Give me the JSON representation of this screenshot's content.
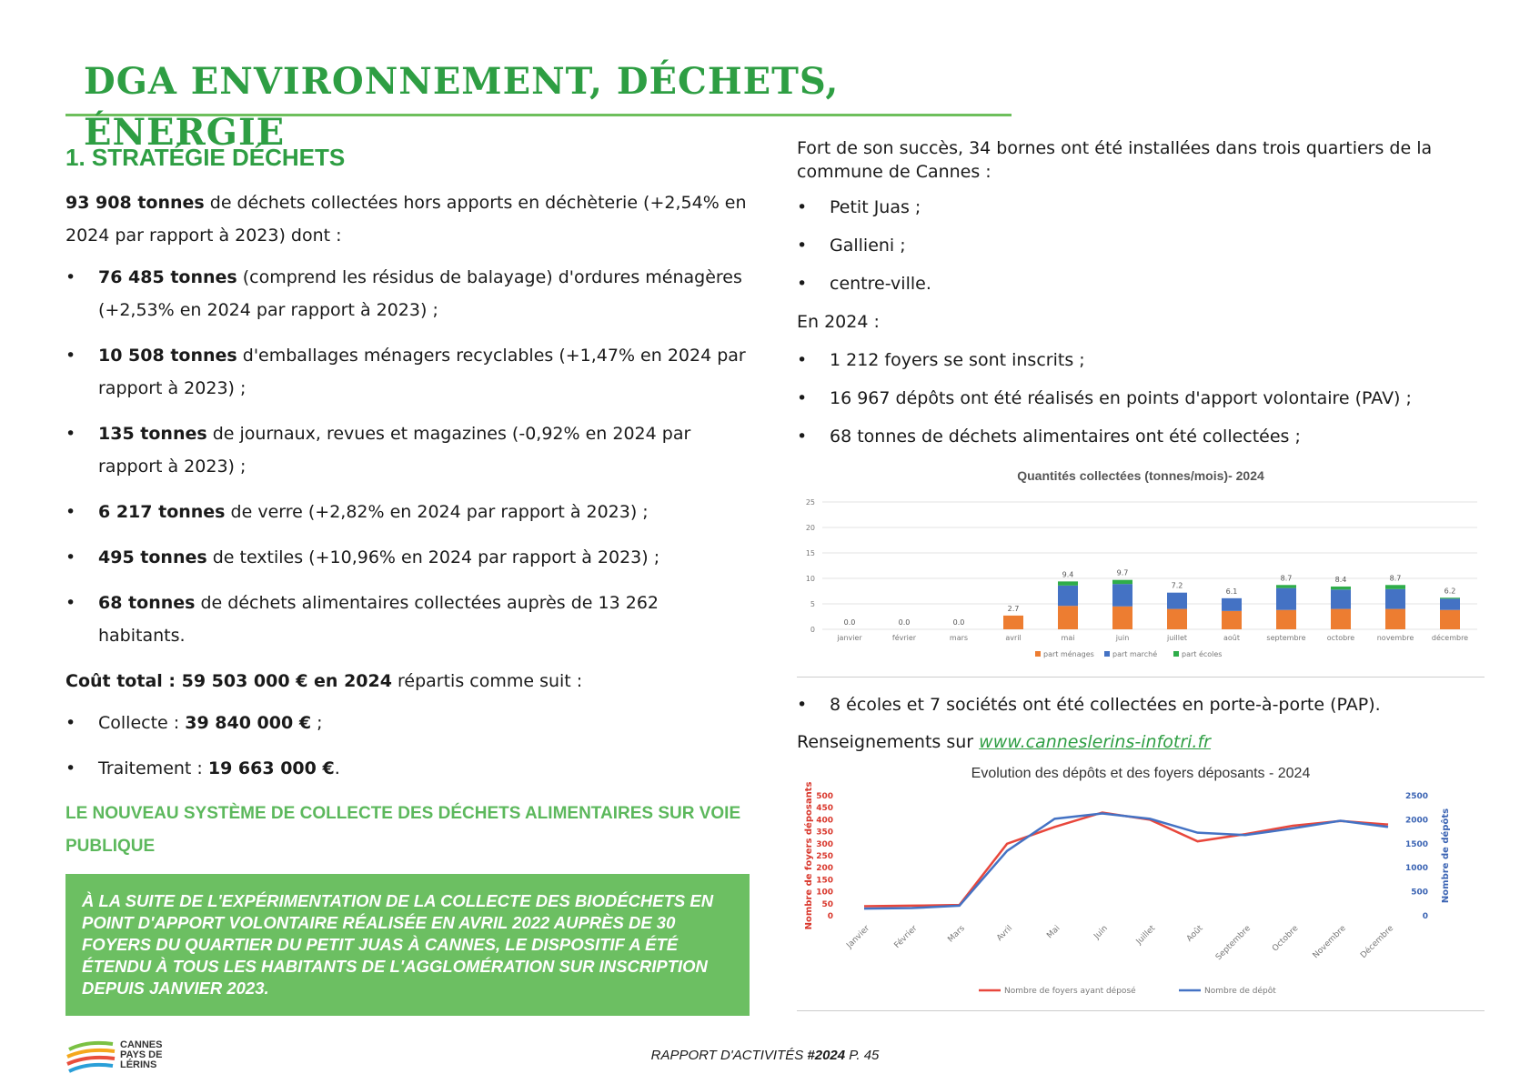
{
  "header": {
    "title": "DGA ENVIRONNEMENT, DÉCHETS, ÉNERGIE"
  },
  "left": {
    "section_title": "1. STRATÉGIE DÉCHETS",
    "intro_bold": "93 908 tonnes",
    "intro_rest": " de déchets collectées hors apports en déchèterie (+2,54% en 2024 par rapport à 2023) dont :",
    "items": [
      {
        "bold": "76 485 tonnes",
        "rest": " (comprend les résidus de balayage) d'ordures ménagères (+2,53% en 2024 par rapport à 2023) ;"
      },
      {
        "bold": "10 508 tonnes",
        "rest": " d'emballages ménagers recyclables (+1,47% en 2024 par rapport à 2023) ;"
      },
      {
        "bold": "135 tonnes",
        "rest": " de journaux, revues et magazines (-0,92% en 2024 par rapport à 2023) ;"
      },
      {
        "bold": "6 217 tonnes",
        "rest": " de verre (+2,82% en 2024 par rapport à 2023) ;"
      },
      {
        "bold": "495 tonnes",
        "rest": " de textiles (+10,96% en 2024 par rapport à 2023) ;"
      },
      {
        "bold": "68 tonnes",
        "rest": " de déchets alimentaires collectées auprès de 13 262 habitants."
      }
    ],
    "cost_bold": "Coût total : 59 503 000 € en 2024",
    "cost_rest": " répartis comme suit :",
    "cost_items": [
      {
        "label": "Collecte : ",
        "bold": "39 840 000 €",
        "rest": " ;"
      },
      {
        "label": "Traitement : ",
        "bold": "19 663 000 €",
        "rest": "."
      }
    ],
    "subtitle": "LE NOUVEAU SYSTÈME DE COLLECTE DES DÉCHETS ALIMENTAIRES SUR VOIE PUBLIQUE",
    "box_text": "À LA SUITE DE L'EXPÉRIMENTATION DE LA COLLECTE DES BIODÉCHETS EN POINT D'APPORT VOLONTAIRE RÉALISÉE EN AVRIL 2022 AUPRÈS DE 30 FOYERS DU QUARTIER DU PETIT JUAS À CANNES, LE DISPOSITIF A ÉTÉ ÉTENDU À TOUS LES HABITANTS DE L'AGGLOMÉRATION SUR INSCRIPTION DEPUIS JANVIER 2023."
  },
  "right": {
    "para1": "Fort de son succès, 34 bornes ont été installées dans trois quartiers de la commune de Cannes :",
    "quartiers": [
      "Petit Juas ;",
      "Gallieni ;",
      "centre-ville."
    ],
    "en2024": "En 2024 :",
    "stats": [
      "1 212 foyers se sont inscrits ;",
      "16 967 dépôts ont été réalisés en points d'apport volontaire (PAV) ;",
      "68 tonnes de déchets alimentaires ont été collectées ;"
    ],
    "pap": "8 écoles et 7 sociétés ont été collectées en porte-à-porte (PAP).",
    "rens_label": "Renseignements sur ",
    "rens_link": "www.canneslerins-infotri.fr"
  },
  "chart_data": [
    {
      "type": "bar",
      "title": "Quantités collectées (tonnes/mois)- 2024",
      "categories": [
        "janvier",
        "février",
        "mars",
        "avril",
        "mai",
        "juin",
        "juillet",
        "août",
        "septembre",
        "octobre",
        "novembre",
        "décembre"
      ],
      "series": [
        {
          "name": "part ménages",
          "color": "#ed7d31",
          "values": [
            0,
            0,
            0,
            2.7,
            4.6,
            4.5,
            4.0,
            3.6,
            3.8,
            4.0,
            4.0,
            3.8
          ]
        },
        {
          "name": "part marché",
          "color": "#4472c4",
          "values": [
            0,
            0,
            0,
            0,
            4.0,
            4.4,
            3.2,
            2.5,
            4.3,
            3.8,
            3.9,
            2.2
          ]
        },
        {
          "name": "part écoles",
          "color": "#2fad4a",
          "values": [
            0,
            0,
            0,
            0,
            0.8,
            0.8,
            0,
            0,
            0.6,
            0.6,
            0.8,
            0.2
          ]
        }
      ],
      "totals": [
        "0.0",
        "0.0",
        "0.0",
        "2.7",
        "9.4",
        "9.7",
        "7.2",
        "6.1",
        "8.7",
        "8.4",
        "8.7",
        "6.2"
      ],
      "ylim": [
        0,
        25
      ],
      "yticks": [
        "0",
        "5",
        "10",
        "15",
        "20",
        "25"
      ],
      "legend": "bottom",
      "grid": true
    },
    {
      "type": "line",
      "title": "Evolution des dépôts et des foyers déposants - 2024",
      "categories": [
        "Janvier",
        "Février",
        "Mars",
        "Avril",
        "Mai",
        "Juin",
        "Juillet",
        "Août",
        "Septembre",
        "Octobre",
        "Novembre",
        "Décembre"
      ],
      "series": [
        {
          "name": "Nombre de foyers ayant déposé",
          "color": "#e8473c",
          "axis": "left",
          "values": [
            40,
            42,
            45,
            300,
            370,
            430,
            400,
            310,
            340,
            375,
            395,
            380
          ]
        },
        {
          "name": "Nombre de dépôt",
          "color": "#4472c4",
          "axis": "right",
          "values": [
            150,
            160,
            210,
            1350,
            2020,
            2130,
            2020,
            1730,
            1680,
            1820,
            1980,
            1850
          ]
        }
      ],
      "ylabel_left": "Nombre de foyers déposants",
      "ylabel_right": "Nombre de dépôts",
      "ylim_left": [
        0,
        500
      ],
      "ylim_right": [
        0,
        2500
      ],
      "yticks_left": [
        "0",
        "50",
        "100",
        "150",
        "200",
        "250",
        "300",
        "350",
        "400",
        "450",
        "500"
      ],
      "yticks_right": [
        "0",
        "500",
        "1000",
        "1500",
        "2000",
        "2500"
      ],
      "legend": "bottom",
      "grid": false
    }
  ],
  "footer": {
    "logo_name": [
      "CANNES",
      "PAYS DE",
      "LÉRINS"
    ],
    "report_prefix": "RAPPORT D'ACTIVITÉS ",
    "report_year": "#2024",
    "report_page": " P. 45"
  }
}
